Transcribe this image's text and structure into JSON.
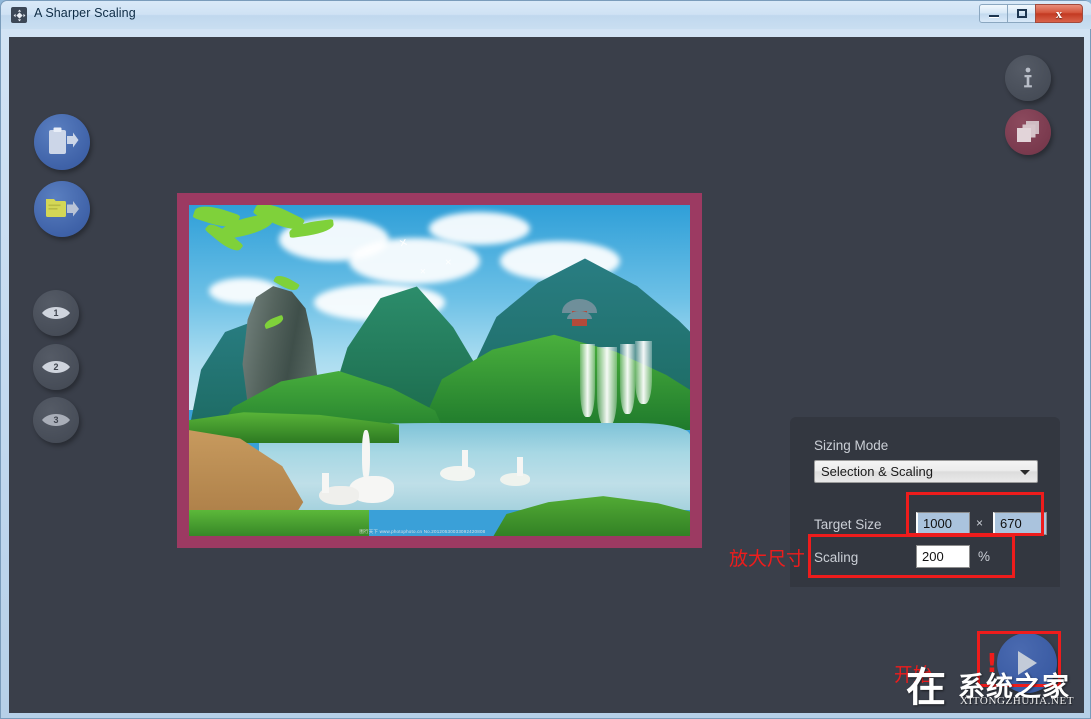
{
  "window": {
    "title": "A Sharper Scaling",
    "app_icon": "move-arrows-icon",
    "controls": {
      "minimize_label": "",
      "maximize_label": "",
      "close_label": "x"
    }
  },
  "sidebar": {
    "items": [
      {
        "name": "paste-from-clipboard-button",
        "icon": "clipboard-arrow-icon",
        "label": ""
      },
      {
        "name": "open-file-button",
        "icon": "folder-arrow-icon",
        "label": ""
      },
      {
        "name": "preview-step-1-button",
        "icon": "eye-icon",
        "label": "1"
      },
      {
        "name": "preview-step-2-button",
        "icon": "eye-icon",
        "label": "2"
      },
      {
        "name": "preview-step-3-button",
        "icon": "eye-icon",
        "label": "3"
      }
    ]
  },
  "toolbar_right": {
    "info_label": "i",
    "info_icon": "info-icon",
    "batch_icon": "stacked-layers-icon"
  },
  "start_button": {
    "icon": "play-icon",
    "label": ""
  },
  "settings": {
    "sizing_mode_label": "Sizing Mode",
    "sizing_mode_value": "Selection & Scaling",
    "sizing_mode_options": [
      "Selection & Scaling"
    ],
    "target_size_label": "Target Size",
    "target_width": "1000",
    "target_height": "670",
    "target_separator": "×",
    "scaling_label": "Scaling",
    "scaling_value": "200",
    "scaling_unit": "%"
  },
  "image": {
    "photo_watermark": "图行天下  www.photophoto.cn   No.20120530033092420808",
    "selection_border_color": "#9c3a62"
  },
  "annotations": [
    {
      "name": "annotation-target-size-box",
      "text": "",
      "color": "#ee1c1c"
    },
    {
      "name": "annotation-scaling-box",
      "text": "",
      "color": "#ee1c1c"
    },
    {
      "name": "annotation-start-box",
      "text": "",
      "color": "#ee1c1c"
    }
  ],
  "annotation_text": {
    "zoom_size": "放大尺寸",
    "start": "开始",
    "start_mark": "!"
  },
  "watermark": {
    "logo": "在",
    "site_cn": "系统之家",
    "site_url": "XITONGZHUJIA.NET"
  },
  "colors": {
    "accent_blue": "#3f62a8",
    "panel_bg": "#333740",
    "canvas_bg": "#3a3f4a",
    "annotation_red": "#ee1c1c",
    "selection_magenta": "#9c3a62"
  }
}
